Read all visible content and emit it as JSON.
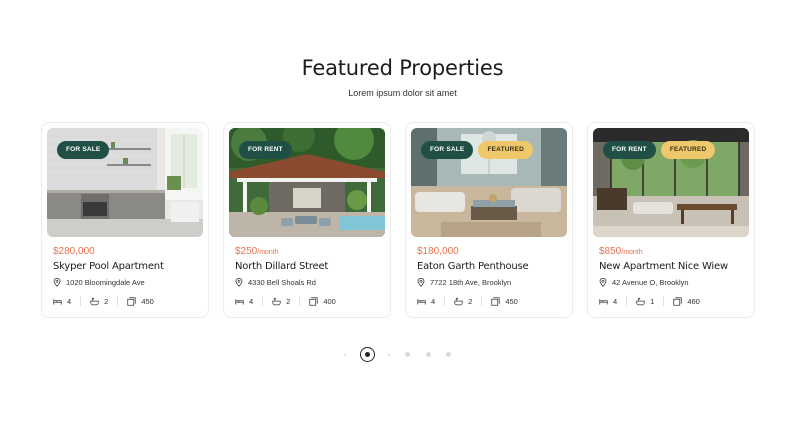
{
  "header": {
    "title": "Featured Properties",
    "subtitle": "Lorem ipsum dolor sit amet"
  },
  "cards": [
    {
      "badges": [
        "FOR SALE"
      ],
      "price": "$280,000",
      "price_suffix": "",
      "name": "Skyper Pool Apartment",
      "address": "1020 Bloomingdale Ave",
      "beds": "4",
      "baths": "2",
      "area": "450",
      "image": "kitchen"
    },
    {
      "badges": [
        "FOR RENT"
      ],
      "price": "$250",
      "price_suffix": "/month",
      "name": "North Dillard Street",
      "address": "4330 Bell Shoals Rd",
      "beds": "4",
      "baths": "2",
      "area": "400",
      "image": "patio"
    },
    {
      "badges": [
        "FOR SALE",
        "FEATURED"
      ],
      "price": "$180,000",
      "price_suffix": "",
      "name": "Eaton Garth Penthouse",
      "address": "7722 18th Ave, Brooklyn",
      "beds": "4",
      "baths": "2",
      "area": "450",
      "image": "living-room"
    },
    {
      "badges": [
        "FOR RENT",
        "FEATURED"
      ],
      "price": "$850",
      "price_suffix": "/month",
      "name": "New Apartment Nice Wiew",
      "address": "42 Avenue O, Brooklyn",
      "beds": "4",
      "baths": "1",
      "area": "460",
      "image": "dining-room"
    }
  ],
  "pagination": {
    "pages": 5,
    "active": 1
  },
  "colors": {
    "accent": "#e8734f",
    "badge_dark": "#1f4f45",
    "badge_featured": "#eec86b"
  },
  "icons": {
    "address": "map-pin-icon",
    "beds": "bed-icon",
    "baths": "bath-icon",
    "area": "area-icon"
  }
}
